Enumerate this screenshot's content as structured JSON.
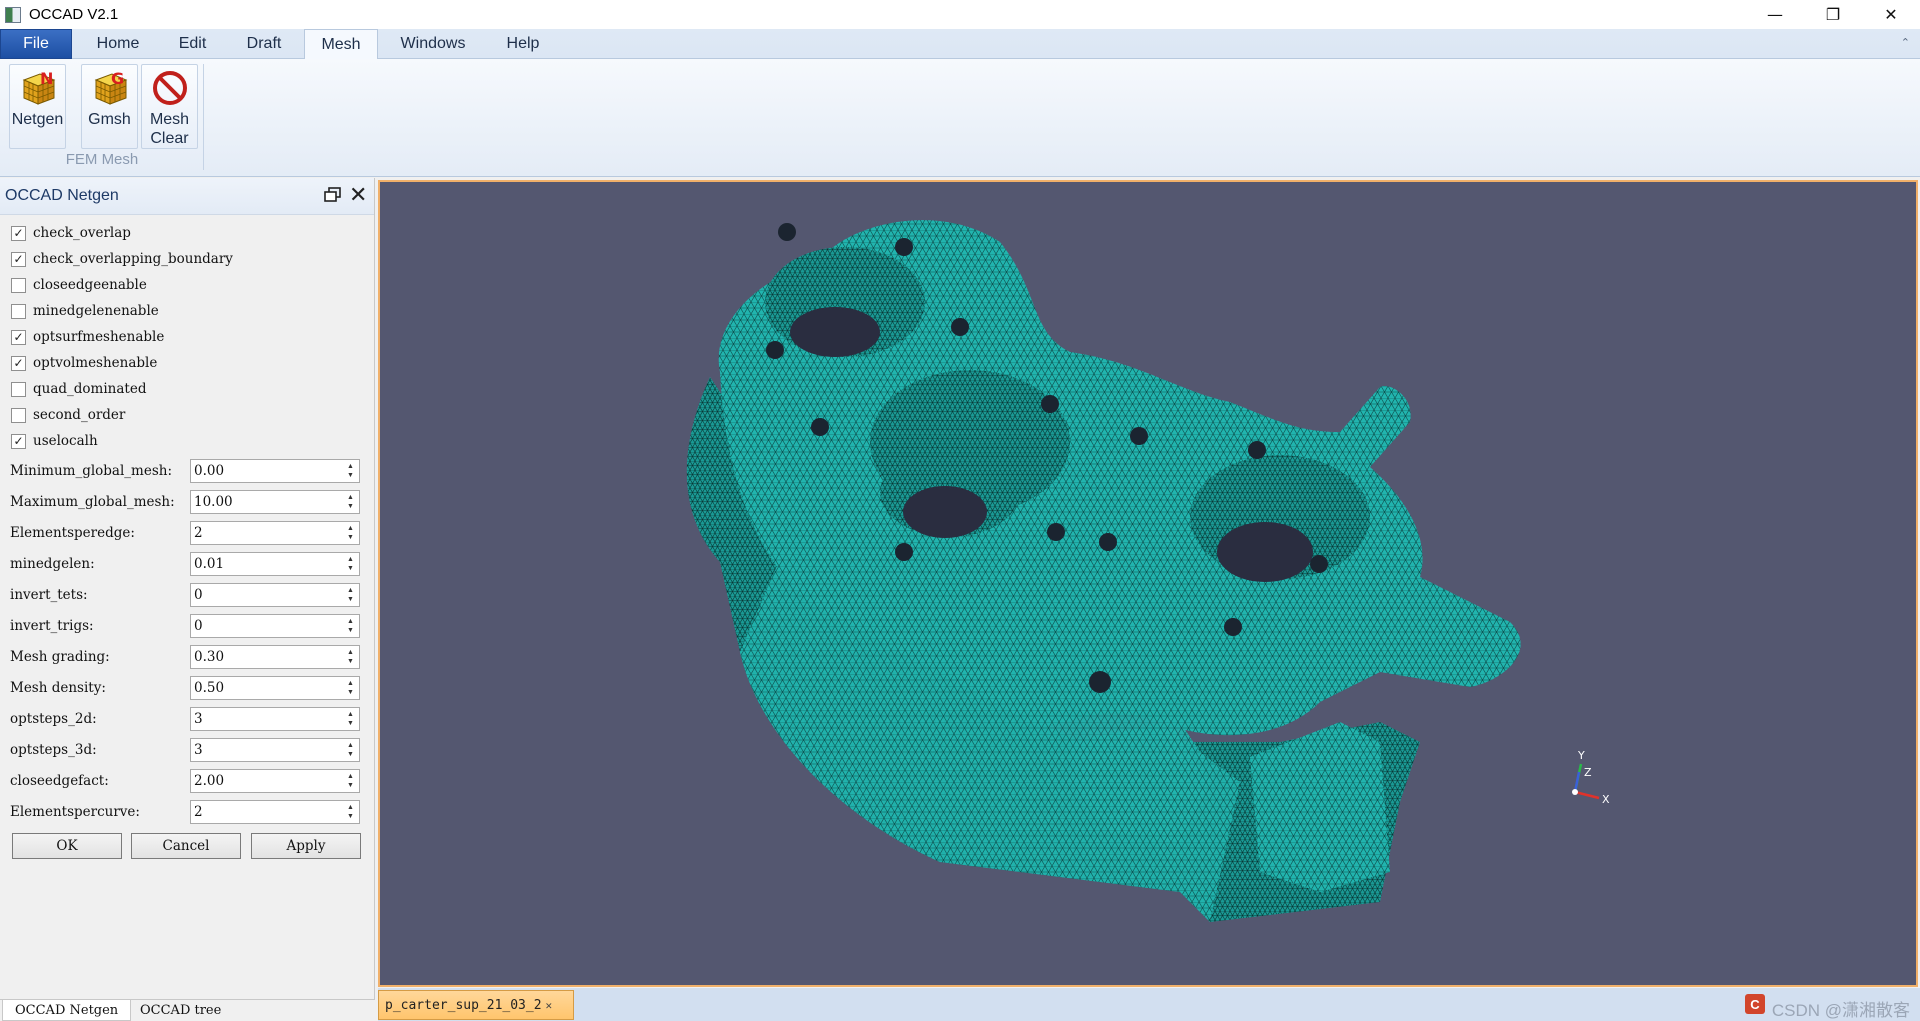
{
  "window": {
    "title": "OCCAD V2.1",
    "controls": [
      "—",
      "❐",
      "✕"
    ]
  },
  "menu": {
    "tabs": [
      "File",
      "Home",
      "Edit",
      "Draft",
      "Mesh",
      "Windows",
      "Help"
    ],
    "active": "Mesh"
  },
  "ribbon": {
    "buttons": [
      {
        "label": "Netgen",
        "icon": "netgen-cube-icon"
      },
      {
        "label": "Gmsh",
        "icon": "gmsh-cube-icon"
      },
      {
        "label": "Mesh\nClear",
        "icon": "no-entry-icon"
      }
    ],
    "group_label": "FEM Mesh"
  },
  "dock": {
    "title": "OCCAD Netgen",
    "options": [
      {
        "label": "check_overlap",
        "checked": true
      },
      {
        "label": "check_overlapping_boundary",
        "checked": true
      },
      {
        "label": "closeedgeenable",
        "checked": false
      },
      {
        "label": "minedgelenenable",
        "checked": false
      },
      {
        "label": "optsurfmeshenable",
        "checked": true
      },
      {
        "label": "optvolmeshenable",
        "checked": true
      },
      {
        "label": "quad_dominated",
        "checked": false
      },
      {
        "label": "second_order",
        "checked": false
      },
      {
        "label": "uselocalh",
        "checked": true
      }
    ],
    "params": [
      {
        "label": "Minimum_global_mesh:",
        "value": "0.00"
      },
      {
        "label": "Maximum_global_mesh:",
        "value": "10.00"
      },
      {
        "label": "Elementsperedge:",
        "value": "2"
      },
      {
        "label": "minedgelen:",
        "value": "0.01"
      },
      {
        "label": "invert_tets:",
        "value": "0"
      },
      {
        "label": "invert_trigs:",
        "value": "0"
      },
      {
        "label": "Mesh grading:",
        "value": "0.30"
      },
      {
        "label": "Mesh density:",
        "value": "0.50"
      },
      {
        "label": "optsteps_2d:",
        "value": "3"
      },
      {
        "label": "optsteps_3d:",
        "value": "3"
      },
      {
        "label": "closeedgefact:",
        "value": "2.00"
      },
      {
        "label": "Elementspercurve:",
        "value": "2"
      }
    ],
    "buttons": {
      "ok": "OK",
      "cancel": "Cancel",
      "apply": "Apply"
    },
    "bottom_tabs": [
      "OCCAD Netgen",
      "OCCAD tree"
    ]
  },
  "viewport": {
    "background": "#545770",
    "mesh_color": "#22b3ae",
    "axis_labels": {
      "x": "X",
      "y": "Y",
      "z": "Z"
    }
  },
  "document_tab": {
    "label": "p_carter_sup_21_03_2",
    "close": "✕"
  },
  "watermark": {
    "text": "CSDN @潇湘散客",
    "logo": "C"
  }
}
